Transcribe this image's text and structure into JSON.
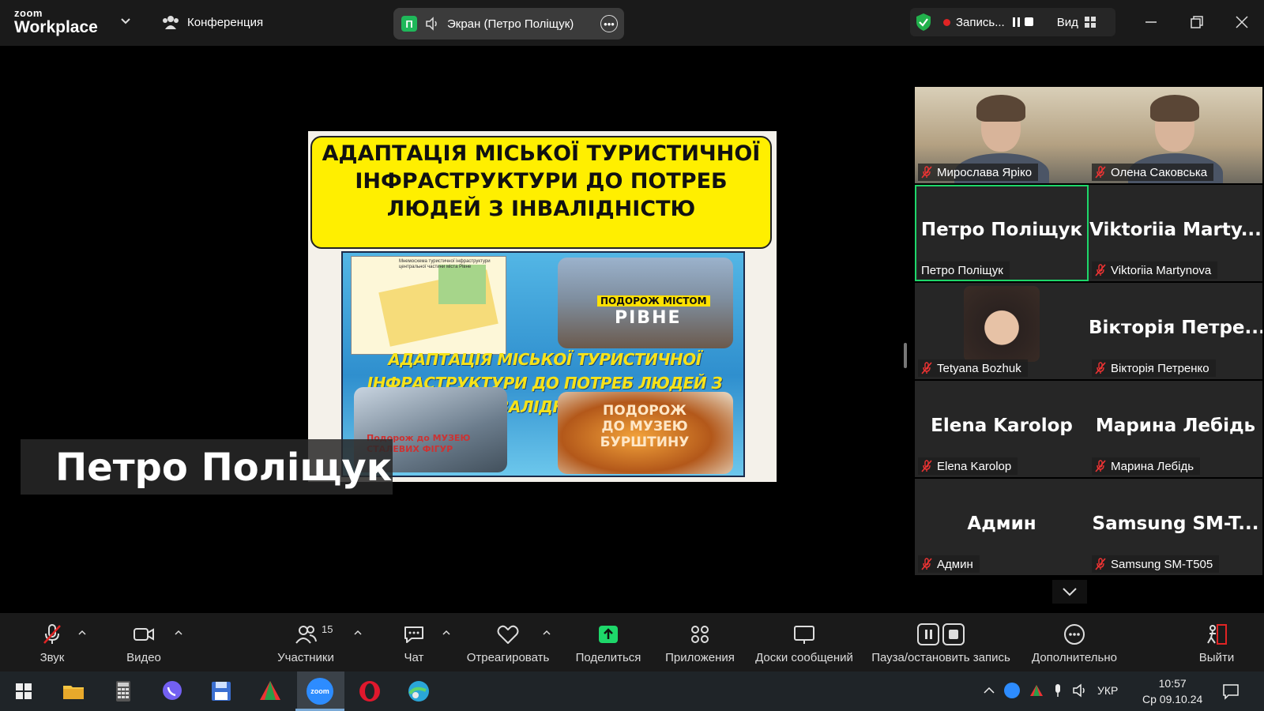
{
  "window": {
    "logo_small": "zoom",
    "logo_big": "Workplace",
    "meeting_label": "Конференция",
    "share_label": "Экран (Петро Поліщук)",
    "share_badge": "П",
    "recording_label": "Запись...",
    "view_label": "Вид"
  },
  "slide": {
    "title": "АДАПТАЦІЯ МІСЬКОЇ ТУРИСТИЧНОЇ ІНФРАСТРУКТУРИ ДО ПОТРЕБ ЛЮДЕЙ З ІНВАЛІДНІСТЮ",
    "map_caption": "Мнемосхема туристичної інфраструктури центральної частини міста Рівне",
    "city_label_1": "ПОДОРОЖ МІСТОМ",
    "city_label_2": "РІВНЕ",
    "poster_caption": "АДАПТАЦІЯ МІСЬКОЇ ТУРИСТИЧНОЇ ІНФРАСТРУКТУРИ ДО ПОТРЕБ ЛЮДЕЙ З ІНВАЛІДНІСТЮ",
    "sculpture_label": "Подорож до МУЗЕЮ СТАЛЕВИХ ФІГУР",
    "amber_label": "ПОДОРОЖ ДО МУЗЕЮ БУРШТИНУ"
  },
  "speaker_name": "Петро Поліщук",
  "gallery": [
    {
      "display": "",
      "label": "Мирослава Яріко",
      "muted": true,
      "video": true
    },
    {
      "display": "",
      "label": "Олена Саковська",
      "muted": true,
      "video": true
    },
    {
      "display": "Петро Поліщук",
      "label": "Петро Поліщук",
      "muted": false,
      "active": true
    },
    {
      "display": "Viktoriia Marty...",
      "label": "Viktoriia Martynova",
      "muted": true
    },
    {
      "display": "",
      "label": "Tetyana Bozhuk",
      "muted": true,
      "avatar": true
    },
    {
      "display": "Вікторія Петре...",
      "label": "Вікторія Петренко",
      "muted": true
    },
    {
      "display": "Elena Karolop",
      "label": "Elena Karolop",
      "muted": true
    },
    {
      "display": "Марина Лебідь",
      "label": "Марина Лебідь",
      "muted": true
    },
    {
      "display": "Админ",
      "label": "Админ",
      "muted": true
    },
    {
      "display": "Samsung SM-T...",
      "label": "Samsung SM-T505",
      "muted": true
    }
  ],
  "toolbar": {
    "audio": "Звук",
    "video": "Видео",
    "participants": "Участники",
    "participants_count": "15",
    "chat": "Чат",
    "react": "Отреагировать",
    "share": "Поделиться",
    "apps": "Приложения",
    "whiteboards": "Доски сообщений",
    "record": "Пауза/остановить запись",
    "more": "Дополнительно",
    "leave": "Выйти"
  },
  "taskbar": {
    "lang": "УКР",
    "time": "10:57",
    "date": "Ср 09.10.24",
    "zoom_label": "zoom"
  }
}
